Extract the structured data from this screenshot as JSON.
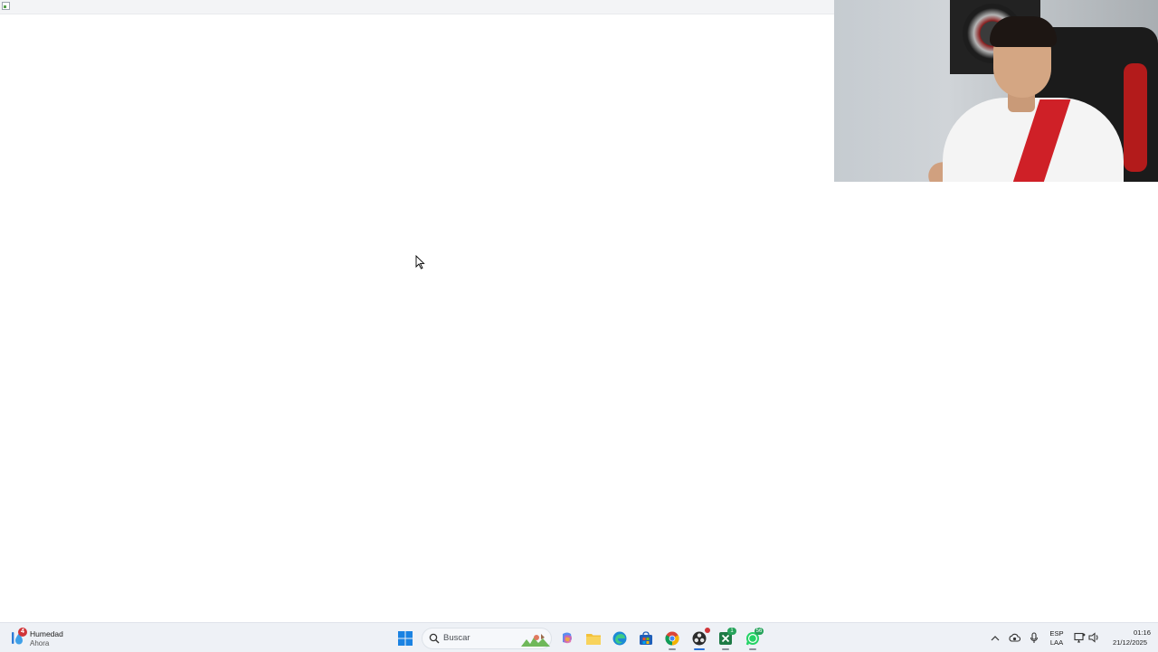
{
  "taskbar": {
    "widget": {
      "title": "Humedad",
      "subtitle": "Ahora",
      "badge": "4",
      "icon": "humidity-icon"
    },
    "search": {
      "placeholder": "Buscar",
      "icon": "search-icon"
    },
    "apps": [
      {
        "name": "start",
        "icon": "windows-start-icon"
      },
      {
        "name": "copilot",
        "icon": "copilot-icon"
      },
      {
        "name": "file-explorer",
        "icon": "folder-icon"
      },
      {
        "name": "edge",
        "icon": "edge-icon"
      },
      {
        "name": "store",
        "icon": "store-icon"
      },
      {
        "name": "chrome",
        "icon": "chrome-icon"
      },
      {
        "name": "obs",
        "icon": "obs-icon"
      },
      {
        "name": "excel",
        "icon": "excel-icon",
        "badge": "1"
      },
      {
        "name": "whatsapp",
        "icon": "whatsapp-icon",
        "badge": "56"
      }
    ],
    "tray": {
      "language_line1": "ESP",
      "language_line2": "LAA",
      "time": "01:16",
      "date": "21/12/2025"
    }
  },
  "colors": {
    "taskbar_bg": "#eef1f6",
    "accent": "#2a6fd6",
    "badge_red": "#d13438"
  }
}
